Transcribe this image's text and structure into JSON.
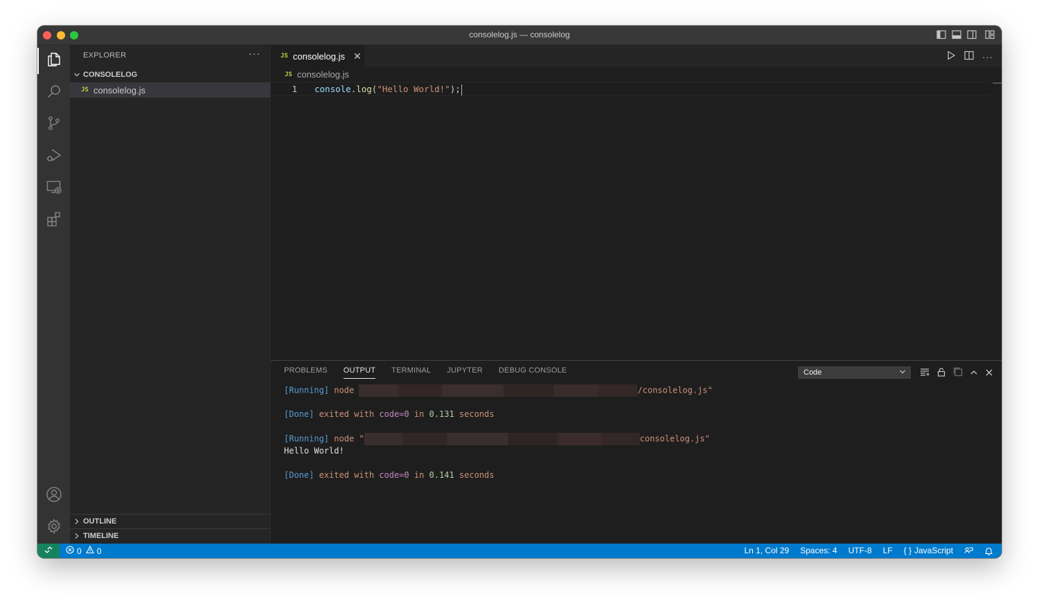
{
  "window": {
    "title": "consolelog.js — consolelog"
  },
  "explorer": {
    "title": "EXPLORER",
    "more": "···",
    "folder": "CONSOLELOG",
    "files": [
      {
        "badge": "JS",
        "name": "consolelog.js"
      }
    ],
    "outline": "OUTLINE",
    "timeline": "TIMELINE"
  },
  "editor": {
    "tab": {
      "badge": "JS",
      "name": "consolelog.js",
      "close": "✕"
    },
    "breadcrumb": {
      "badge": "JS",
      "name": "consolelog.js"
    },
    "lines": [
      {
        "number": "1",
        "tokens": {
          "obj": "console",
          "dot": ".",
          "fn": "log",
          "open": "(",
          "str": "\"Hello World!\"",
          "close": ");"
        }
      }
    ]
  },
  "panel": {
    "tabs": [
      "PROBLEMS",
      "OUTPUT",
      "TERMINAL",
      "JUPYTER",
      "DEBUG CONSOLE"
    ],
    "active_tab": "OUTPUT",
    "channel": "Code",
    "output": {
      "run1": {
        "tag": "[Running]",
        "cmd": "node ",
        "path_end": "/consolelog.js\""
      },
      "done1": {
        "tag": "[Done]",
        "pre": " exited with ",
        "code": "code=0",
        "mid": " in ",
        "time": "0.131",
        "post": " seconds"
      },
      "run2": {
        "tag": "[Running]",
        "cmd": "node \"",
        "path_end": "consolelog.js\""
      },
      "stdout": "Hello World!",
      "done2": {
        "tag": "[Done]",
        "pre": " exited with ",
        "code": "code=0",
        "mid": " in ",
        "time": "0.141",
        "post": " seconds"
      }
    }
  },
  "statusbar": {
    "errors": "0",
    "warnings": "0",
    "position": "Ln 1, Col 29",
    "spaces": "Spaces: 4",
    "encoding": "UTF-8",
    "eol": "LF",
    "language_icon": "{ }",
    "language": "JavaScript"
  },
  "colors": {
    "statusbar": "#007acc",
    "remote": "#16825d",
    "js_badge": "#cbcb41"
  }
}
